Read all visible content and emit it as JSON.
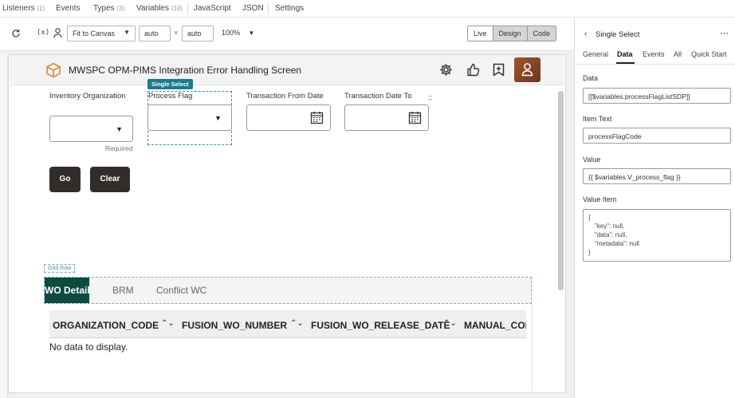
{
  "topbar": {
    "tabs": [
      {
        "label": "Listeners",
        "count": "(1)"
      },
      {
        "label": "Events",
        "count": ""
      },
      {
        "label": "Types",
        "count": "(3)"
      },
      {
        "label": "Variables",
        "count": "(10)"
      },
      {
        "label": "JavaScript",
        "count": ""
      },
      {
        "label": "JSON",
        "count": ""
      },
      {
        "label": "Settings",
        "count": ""
      }
    ]
  },
  "toolbar": {
    "fit_label": "Fit to Canvas",
    "width_value": "auto",
    "times_symbol": "×",
    "height_value": "auto",
    "zoom_label": "100%",
    "modes": [
      "Live",
      "Design",
      "Code"
    ],
    "active_mode": "Design"
  },
  "app": {
    "title": "MWSPC OPM-PIMS Integration Error Handling Screen",
    "brand_color": "#f0a35a",
    "avatar_color": "#8b4a2b"
  },
  "form": {
    "inventory_label": "Inventory Organization",
    "required_text": "Required",
    "selected_badge": "Single Select",
    "process_flag_label": "Process Flag",
    "from_date_label": "Transaction From Date",
    "to_date_label": "Transaction Date To",
    "stray_text": ";;",
    "go_label": "Go",
    "clear_label": "Clear"
  },
  "grid_row_badge": "Grid Row",
  "tabs": {
    "items": [
      "WO Detail",
      "BRM",
      "Conflict WC"
    ],
    "active": "WO Detail",
    "active_color": "#0d4a40"
  },
  "table": {
    "columns": [
      "ORGANIZATION_CODE",
      "FUSION_WO_NUMBER",
      "FUSION_WO_RELEASE_DATE",
      "MANUAL_COM"
    ],
    "empty_text": "No data to display."
  },
  "panel": {
    "back_label": "Single Select",
    "tabs": [
      "General",
      "Data",
      "Events",
      "All",
      "Quick Start"
    ],
    "active_tab": "Data",
    "data_label": "Data",
    "data_value": "[[$variables.processFlagListSDP]]",
    "item_text_label": "Item Text",
    "item_text_value": "processFlagCode",
    "value_label": "Value",
    "value_value": "{{ $variables.V_process_flag }}",
    "value_item_label": "Value Item",
    "value_item_lines": [
      "{",
      "\"key\": null,",
      "\"data\": null,",
      "\"metadata\": null",
      "}"
    ]
  }
}
